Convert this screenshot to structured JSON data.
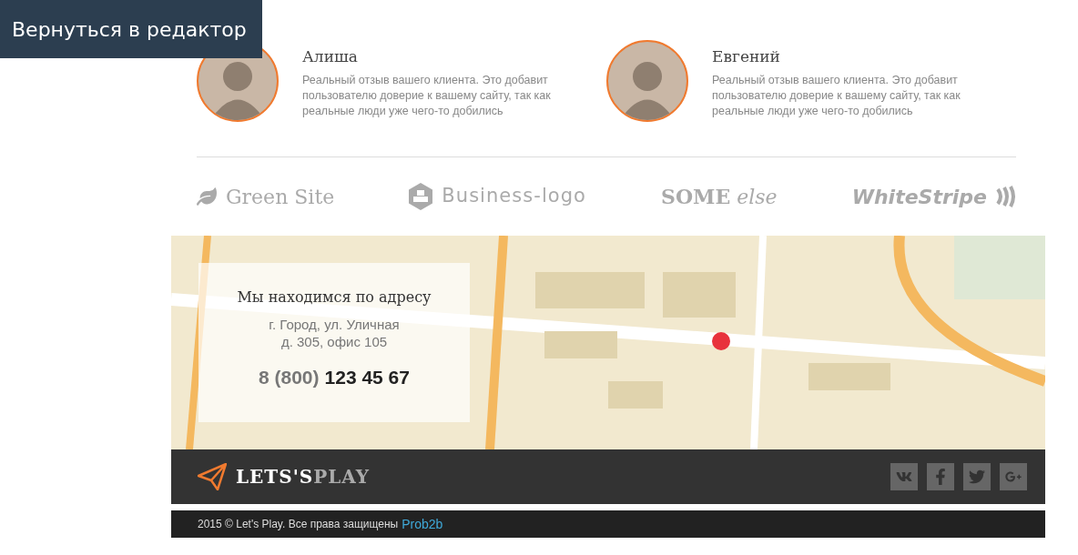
{
  "editor_button": "Вернуться в редактор",
  "testimonials": [
    {
      "name": "Алиша",
      "text": "Реальный отзыв вашего клиента. Это добавит пользователю доверие к вашему сайту, так как реальные люди уже чего-то добились"
    },
    {
      "name": "Евгений",
      "text": "Реальный отзыв вашего клиента. Это добавит пользователю доверие к вашему сайту, так как реальные люди уже чего-то добились"
    }
  ],
  "logos": [
    {
      "kind": "leaf",
      "text": "Green Site"
    },
    {
      "kind": "hexagon",
      "text": "Business-logo"
    },
    {
      "kind": "plain",
      "text": "**SOME** *else*"
    },
    {
      "kind": "stripes",
      "text": "WhiteStripe"
    }
  ],
  "address_card": {
    "title": "Мы находимся по адресу",
    "lines": [
      "г. Город, ул. Уличная",
      "д. 305, офис 105"
    ],
    "phone_code": "8 (800)",
    "phone_number": "123 45 67"
  },
  "footer": {
    "brand_primary": "LETS'S",
    "brand_secondary": "PLAY",
    "social": [
      {
        "kind": "vk"
      },
      {
        "kind": "facebook"
      },
      {
        "kind": "twitter"
      },
      {
        "kind": "google"
      }
    ],
    "copyright": "2015 © Let's Play. Все права защищены",
    "credit_link": "Prob2b"
  }
}
